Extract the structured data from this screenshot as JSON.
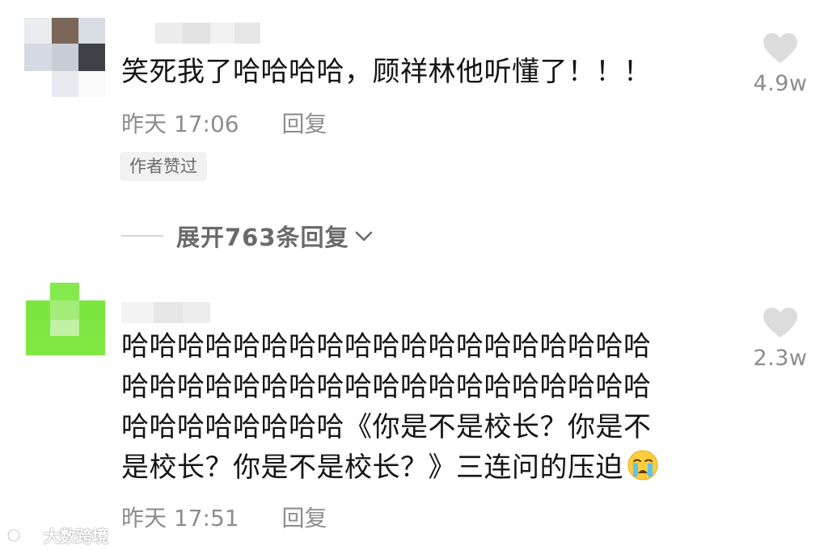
{
  "comments": [
    {
      "text": "笑死我了哈哈哈哈，顾祥林他听懂了！！！",
      "time": "昨天 17:06",
      "reply_label": "回复",
      "badge": "作者赞过",
      "like_count": "4.9w",
      "expand_label": "展开763条回复"
    },
    {
      "text_lines": [
        "哈哈哈哈哈哈哈哈哈哈哈哈哈哈哈哈哈哈哈",
        "哈哈哈哈哈哈哈哈哈哈哈哈哈哈哈哈哈哈哈",
        "哈哈哈哈哈哈哈哈《你是不是校长？你是不",
        "是校长？你是不是校长？》三连问的压迫"
      ],
      "emoji": "crying-face-icon",
      "time": "昨天 17:51",
      "reply_label": "回复",
      "like_count": "2.3w"
    }
  ],
  "watermark": {
    "text": "大数跨境"
  },
  "colors": {
    "text": "#141414",
    "meta": "#8d8d8d",
    "heart": "#dcdcdc",
    "badge_bg": "#f1f1f1",
    "avatar_green": "#7be63f"
  }
}
